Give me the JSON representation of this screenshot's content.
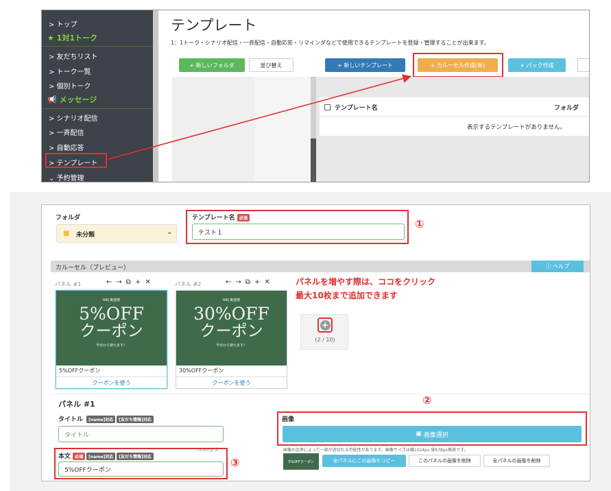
{
  "sidebar": {
    "items": [
      {
        "label": "> トップ"
      },
      {
        "label": "★ 1対1トーク",
        "section": true
      },
      {
        "label": "> 友だちリスト"
      },
      {
        "label": "> トーク一覧"
      },
      {
        "label": "> 個別トーク"
      },
      {
        "label": "📢 メッセージ",
        "section": true
      },
      {
        "label": "> シナリオ配信"
      },
      {
        "label": "> 一斉配信"
      },
      {
        "label": "> 自動応答"
      },
      {
        "label": "> テンプレート"
      },
      {
        "label": "⌄ 予約管理"
      }
    ]
  },
  "main": {
    "title": "テンプレート",
    "description": "1：1トーク・シナリオ配信・一斉配信・自動応答・リマインダなどで使用できるテンプレートを登録・管理することが出来ます。",
    "buttons": {
      "new_folder": "+ 新しいフォルダ",
      "sort": "並び替え",
      "new_template": "+ 新しいテンプレート",
      "carousel": "+ カルーセル作成(新)",
      "pack": "+ パック作成"
    },
    "table_header": {
      "name": "テンプレート名",
      "folder": "フォルダ"
    },
    "empty_message": "表示するテンプレートがありません。"
  },
  "form": {
    "folder_label": "フォルダ",
    "folder_value": "未分類",
    "template_name_label": "テンプレート名",
    "required": "必須",
    "template_name_value": "テスト１",
    "preview_label": "カルーセル（プレビュー）",
    "help": "ヘルプ",
    "panels": [
      {
        "header": "パネル #1",
        "img_small": "ABC美容院",
        "img_big1": "5%OFF",
        "img_big2": "クーポン",
        "img_foot": "今日から使えます！",
        "title": "5%OFFクーポン",
        "action": "クーポンを使う"
      },
      {
        "header": "パネル #2",
        "img_small": "ABC美容院",
        "img_big1": "30%OFF",
        "img_big2": "クーポン",
        "img_foot": "今日から使えます！",
        "title": "30%OFFクーポン",
        "action": "クーポンを使う"
      }
    ],
    "add_count": "(2 / 10)",
    "panel_heading": "パネル #1",
    "title_label": "タイトル",
    "name_badge": "[name]対応",
    "friend_badge": "[友だち情報]対応",
    "title_placeholder": "タイトル",
    "body_label": "本文",
    "body_value": "5%OFFクーポン",
    "counter": "0/40文字",
    "image_label": "画像",
    "image_select": "画像選択",
    "image_note": "画像の比率によって一部が途切れる可能性があります。画像サイズは横1024px 縦678px推奨です。",
    "thumb_text": "5%OFFクーポン",
    "copy_all": "全パネルにこの画像をコピー",
    "delete_this": "このパネルの画像を削除",
    "delete_all": "全パネルの画像を削除"
  },
  "annotations": {
    "line1": "パネルを増やす際は、ココをクリック",
    "line2": "最大10枚まで追加できます",
    "n1": "①",
    "n2": "②",
    "n3": "③"
  },
  "colors": {
    "sidebar": "#3d424b",
    "green": "#5cb85c",
    "blue": "#337ab7",
    "orange": "#f0ad4e",
    "info": "#5bc0de",
    "annot": "#e03030"
  }
}
